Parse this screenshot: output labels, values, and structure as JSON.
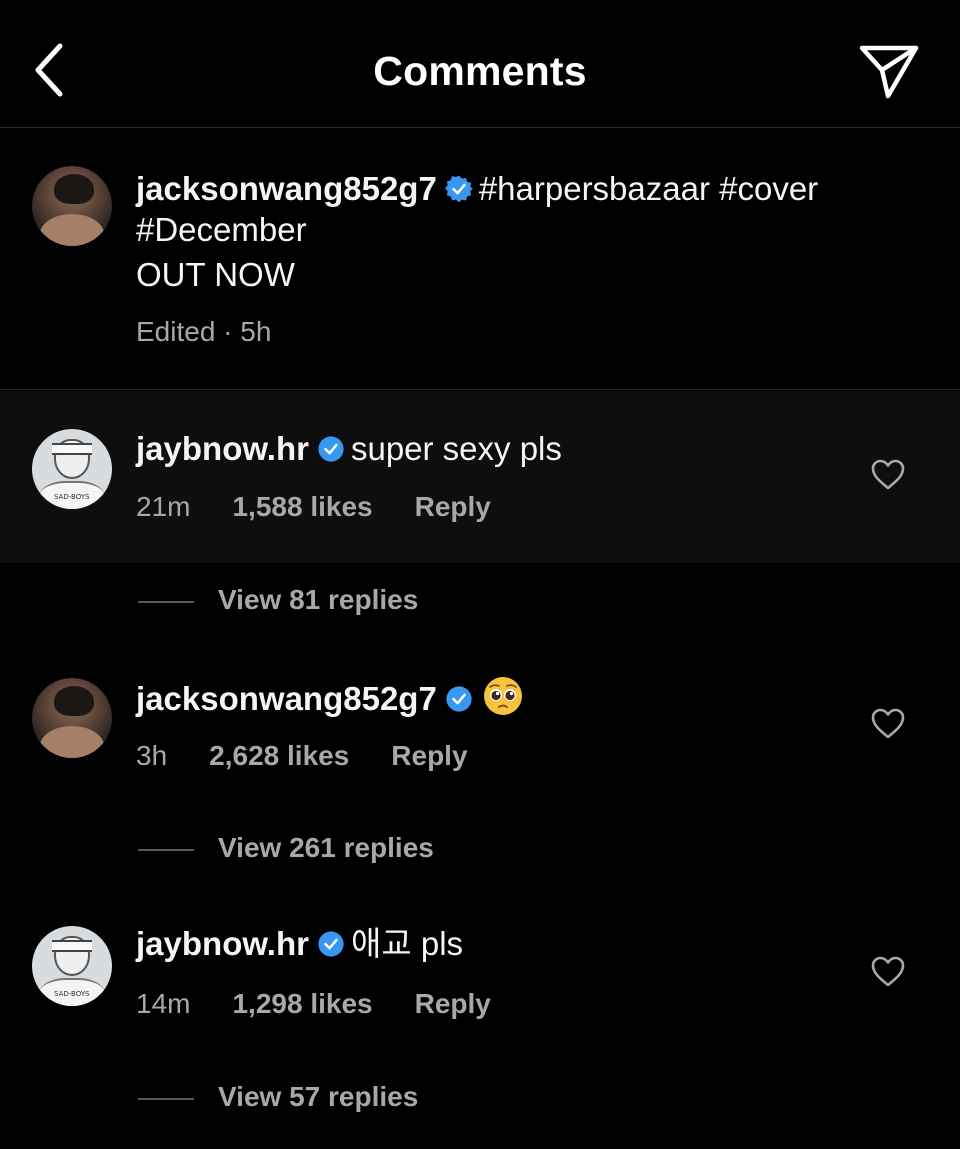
{
  "header": {
    "title": "Comments",
    "back_icon": "chevron-left-icon",
    "share_icon": "paper-plane-icon"
  },
  "caption": {
    "username": "jacksonwang852g7",
    "text_line1": "#harpersbazaar #cover",
    "text_line2": "#December",
    "text_line3": "OUT NOW",
    "meta": "Edited · 5h"
  },
  "comments": [
    {
      "username": "jaybnow.hr",
      "text": "super sexy pls",
      "time": "21m",
      "likes": "1,588 likes",
      "reply": "Reply",
      "view_replies": "View 81 replies"
    },
    {
      "username": "jacksonwang852g7",
      "text": "🥺",
      "time": "3h",
      "likes": "2,628 likes",
      "reply": "Reply",
      "view_replies": "View 261 replies"
    },
    {
      "username": "jaybnow.hr",
      "text": "애교 pls",
      "time": "14m",
      "likes": "1,298 likes",
      "reply": "Reply",
      "view_replies": "View 57 replies"
    }
  ],
  "avatar_shirt_text": "SAD-BOYS",
  "colors": {
    "background": "#000000",
    "text": "#f5f5f5",
    "secondary_text": "#a8a8a8",
    "verified_badge": "#3897f0",
    "divider": "#262626"
  }
}
